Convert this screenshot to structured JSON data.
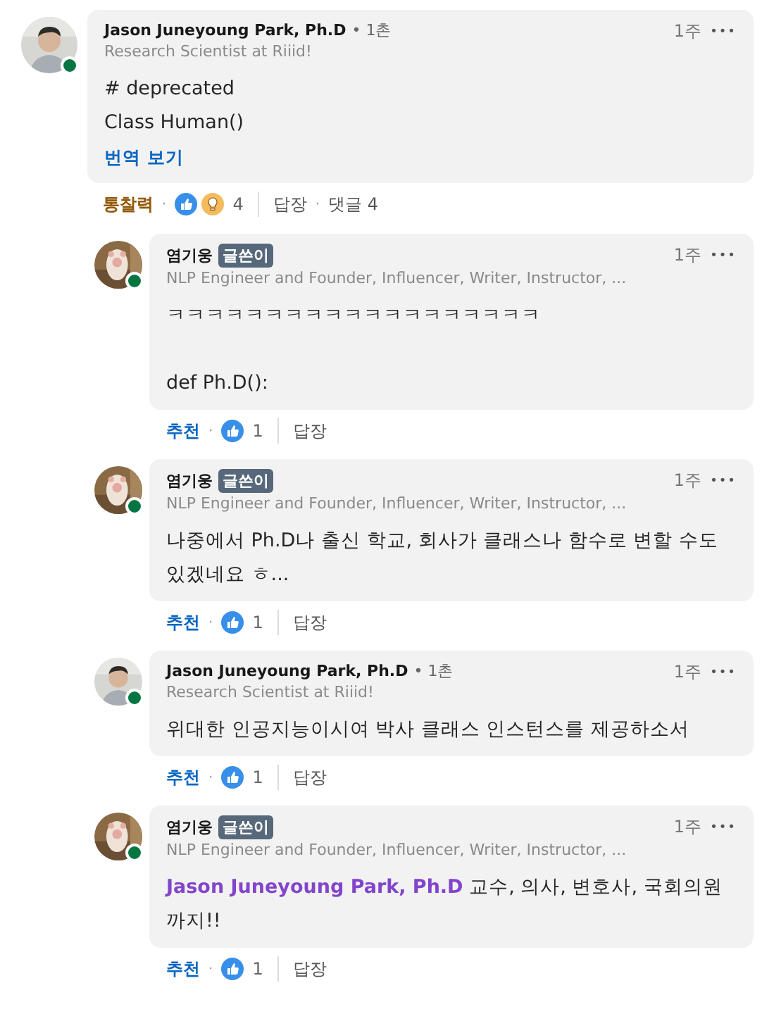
{
  "comment": {
    "author": {
      "name": "Jason Juneyoung Park, Ph.D",
      "degree": "• 1촌",
      "headline": "Research Scientist at Riiid!",
      "online": true
    },
    "time": "1주",
    "more": "•••",
    "paragraphs": [
      [
        "# deprecated",
        "Class Human()"
      ]
    ],
    "translate": "번역 보기",
    "actions": {
      "reaction": {
        "kind": "insight",
        "label": "통찰력"
      },
      "separator": "·",
      "icons": [
        {
          "kind": "like"
        },
        {
          "kind": "insight"
        }
      ],
      "count": "4",
      "reply": "답장",
      "comments": {
        "separator": "·",
        "label": "댓글 4"
      }
    },
    "replies": [
      {
        "author": {
          "name": "염기웅",
          "badge": "글쓴이",
          "headline": "NLP Engineer and Founder, Influencer, Writer, Instructor, ...",
          "online": true
        },
        "time": "1주",
        "more": "•••",
        "paragraphs": [
          [
            "ㅋㅋㅋㅋㅋㅋㅋㅋㅋㅋㅋㅋㅋㅋㅋㅋㅋㅋㅋ"
          ],
          [
            "def Ph.D():"
          ]
        ],
        "actions": {
          "reaction": {
            "kind": "like",
            "label": "추천"
          },
          "separator": "·",
          "icons": [
            {
              "kind": "like"
            }
          ],
          "count": "1",
          "reply": "답장"
        }
      },
      {
        "author": {
          "name": "염기웅",
          "badge": "글쓴이",
          "headline": "NLP Engineer and Founder, Influencer, Writer, Instructor, ...",
          "online": true
        },
        "time": "1주",
        "more": "•••",
        "paragraphs": [
          [
            "나중에서 Ph.D나 출신 학교, 회사가 클래스나 함수로 변할 수도 있겠네요 ㅎ..."
          ]
        ],
        "actions": {
          "reaction": {
            "kind": "like",
            "label": "추천"
          },
          "separator": "·",
          "icons": [
            {
              "kind": "like"
            }
          ],
          "count": "1",
          "reply": "답장"
        }
      },
      {
        "author": {
          "name": "Jason Juneyoung Park, Ph.D",
          "degree": "• 1촌",
          "headline": "Research Scientist at Riiid!",
          "online": true
        },
        "time": "1주",
        "more": "•••",
        "paragraphs": [
          [
            "위대한 인공지능이시여 박사 클래스 인스턴스를 제공하소서"
          ]
        ],
        "actions": {
          "reaction": {
            "kind": "like",
            "label": "추천"
          },
          "separator": "·",
          "icons": [
            {
              "kind": "like"
            }
          ],
          "count": "1",
          "reply": "답장"
        }
      },
      {
        "author": {
          "name": "염기웅",
          "badge": "글쓴이",
          "headline": "NLP Engineer and Founder, Influencer, Writer, Instructor, ...",
          "online": true
        },
        "time": "1주",
        "more": "•••",
        "mention": "Jason Juneyoung Park, Ph.D",
        "paragraphs": [
          [
            "교수, 의사, 변호사, 국회의원 까지!!"
          ]
        ],
        "actions": {
          "reaction": {
            "kind": "like",
            "label": "추천"
          },
          "separator": "·",
          "icons": [
            {
              "kind": "like"
            }
          ],
          "count": "1",
          "reply": "답장"
        }
      }
    ]
  }
}
